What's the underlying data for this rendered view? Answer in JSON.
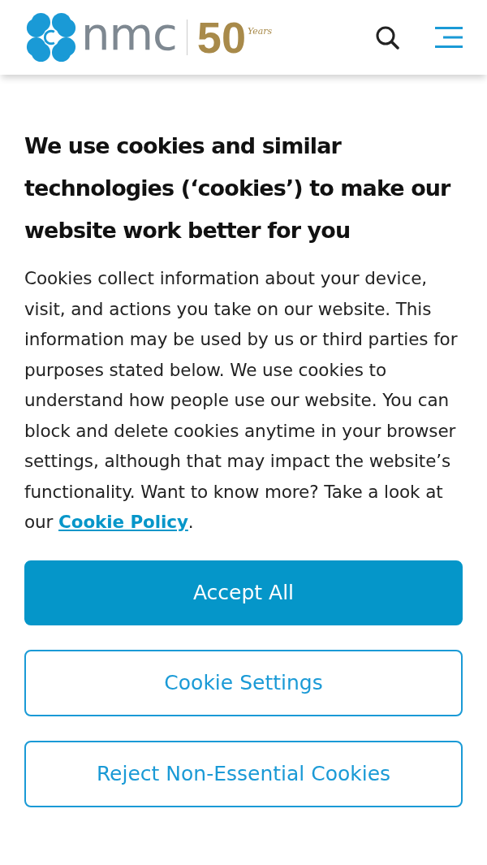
{
  "header": {
    "logo": {
      "wordmark": "nmc",
      "anniversary": "50",
      "anniversary_script": "Years"
    }
  },
  "cookie_banner": {
    "title": "We use cookies and similar technologies (‘cookies’) to make our website work better for you",
    "body": {
      "text": "Cookies collect information about your device, visit, and actions you take on our website. This information may be used by us or third parties for purposes stated below. We use cookies to understand how people use our website. You can block and delete cookies anytime in your browser settings, although that may impact the website’s functionality. Want to know more? Take a look at our ",
      "link": "Cookie Policy",
      "after": "."
    },
    "buttons": [
      {
        "label": "Accept All",
        "kind": "primary"
      },
      {
        "label": "Cookie Settings",
        "kind": "outline"
      },
      {
        "label": "Reject Non-Essential Cookies",
        "kind": "outline"
      }
    ]
  }
}
